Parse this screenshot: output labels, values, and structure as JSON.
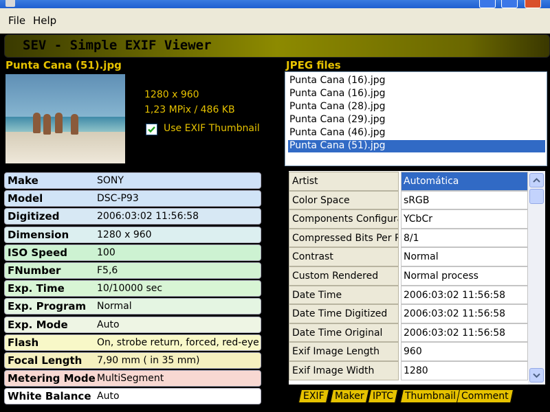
{
  "menubar": {
    "file": "File",
    "help": "Help"
  },
  "banner": {
    "title": "SEV - Simple EXIF Viewer"
  },
  "preview": {
    "filename": "Punta Cana (51).jpg",
    "dimensions": "1280 x 960",
    "size_info": "1,23 MPix / 486 KB",
    "use_thumbnail_label": "Use EXIF Thumbnail",
    "use_thumbnail_checked": true
  },
  "files": {
    "header": "JPEG files",
    "items": [
      "Punta Cana (16).jpg",
      "Punta Cana (16).jpg",
      "Punta Cana (28).jpg",
      "Punta Cana (29).jpg",
      "Punta Cana (46).jpg",
      "Punta Cana (51).jpg"
    ],
    "selected_index": 5
  },
  "summary": [
    {
      "key": "Make",
      "value": "SONY",
      "color": "#cfe2f8"
    },
    {
      "key": "Model",
      "value": "DSC-P93",
      "color": "#d1e4f7"
    },
    {
      "key": "Digitized",
      "value": "2006:03:02 11:56:58",
      "color": "#d7e8f4"
    },
    {
      "key": "Dimension",
      "value": "1280 x 960",
      "color": "#dceff0"
    },
    {
      "key": "ISO Speed",
      "value": "100",
      "color": "#cdf2d2"
    },
    {
      "key": "FNumber",
      "value": "F5,6",
      "color": "#d2f2d2"
    },
    {
      "key": "Exp. Time",
      "value": "10/10000 sec",
      "color": "#d8f5d5"
    },
    {
      "key": "Exp. Program",
      "value": "Normal",
      "color": "#e4f5e2"
    },
    {
      "key": "Exp. Mode",
      "value": "Auto",
      "color": "#eef5e4"
    },
    {
      "key": "Flash",
      "value": "On, strobe return, forced, red-eye",
      "color": "#f8f8c8"
    },
    {
      "key": "Focal Length",
      "value": "7,90 mm  ( in 35 mm)",
      "color": "#f5f0bf"
    },
    {
      "key": "Metering Mode",
      "value": "MultiSegment",
      "color": "#f8d8d2"
    },
    {
      "key": "White Balance",
      "value": "Auto",
      "color": "#ffffff"
    }
  ],
  "exif_table": [
    {
      "key": "Artist",
      "value": "Automática",
      "selected": true
    },
    {
      "key": "Color Space",
      "value": "sRGB"
    },
    {
      "key": "Components Configuration",
      "value": "YCbCr"
    },
    {
      "key": "Compressed Bits Per Pixel",
      "value": "8/1"
    },
    {
      "key": "Contrast",
      "value": "Normal"
    },
    {
      "key": "Custom Rendered",
      "value": "Normal process"
    },
    {
      "key": "Date Time",
      "value": "2006:03:02 11:56:58"
    },
    {
      "key": "Date Time Digitized",
      "value": "2006:03:02 11:56:58"
    },
    {
      "key": "Date Time Original",
      "value": "2006:03:02 11:56:58"
    },
    {
      "key": "Exif Image Length",
      "value": "960"
    },
    {
      "key": "Exif Image Width",
      "value": "1280"
    }
  ],
  "tabs": [
    "EXIF",
    "Maker",
    "IPTC",
    "Thumbnail",
    "Comment"
  ]
}
